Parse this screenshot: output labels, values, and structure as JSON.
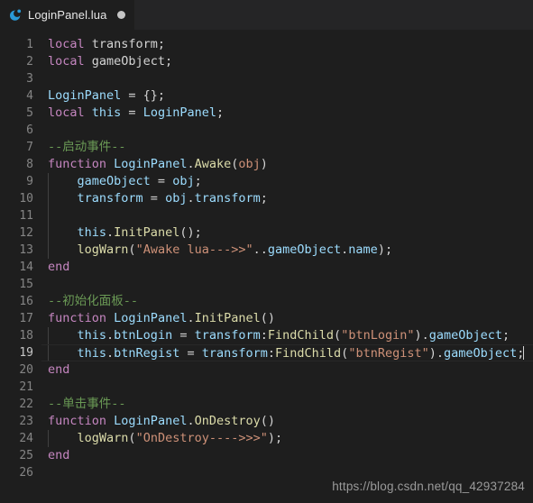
{
  "window": {
    "background_color": "#1e1e1e",
    "tabbar_color": "#252526"
  },
  "tabbar": {
    "tabs": [
      {
        "label": "LoginPanel.lua",
        "icon": "lua-moon-icon",
        "dirty_indicator": "dirty-dot",
        "active": true
      }
    ]
  },
  "editor": {
    "language": "lua",
    "active_line": 19,
    "cursor_line": 19,
    "colors": {
      "keyword": "#c586c0",
      "variable": "#9cdcfe",
      "function": "#dcdcaa",
      "string": "#ce9178",
      "comment": "#6a9955",
      "plain": "#d4d4d4",
      "line_number": "#858585",
      "paren": "#ffd700"
    },
    "lines": [
      {
        "n": "1",
        "indent_guide": false,
        "tokens": [
          {
            "t": "local",
            "c": "kw"
          },
          {
            "t": " transform;",
            "c": "plain"
          }
        ]
      },
      {
        "n": "2",
        "indent_guide": false,
        "tokens": [
          {
            "t": "local",
            "c": "kw"
          },
          {
            "t": " gameObject;",
            "c": "plain"
          }
        ]
      },
      {
        "n": "3",
        "indent_guide": false,
        "tokens": []
      },
      {
        "n": "4",
        "indent_guide": false,
        "tokens": [
          {
            "t": "LoginPanel",
            "c": "var"
          },
          {
            "t": " = {};",
            "c": "plain"
          }
        ]
      },
      {
        "n": "5",
        "indent_guide": false,
        "tokens": [
          {
            "t": "local",
            "c": "kw"
          },
          {
            "t": " ",
            "c": "plain"
          },
          {
            "t": "this",
            "c": "var"
          },
          {
            "t": " = ",
            "c": "plain"
          },
          {
            "t": "LoginPanel",
            "c": "var"
          },
          {
            "t": ";",
            "c": "plain"
          }
        ]
      },
      {
        "n": "6",
        "indent_guide": false,
        "tokens": []
      },
      {
        "n": "7",
        "indent_guide": false,
        "tokens": [
          {
            "t": "--启动事件--",
            "c": "comment"
          }
        ]
      },
      {
        "n": "8",
        "indent_guide": false,
        "tokens": [
          {
            "t": "function",
            "c": "kw"
          },
          {
            "t": " ",
            "c": "plain"
          },
          {
            "t": "LoginPanel",
            "c": "var"
          },
          {
            "t": ".",
            "c": "plain"
          },
          {
            "t": "Awake",
            "c": "func"
          },
          {
            "t": "(",
            "c": "plain"
          },
          {
            "t": "obj",
            "c": "param"
          },
          {
            "t": ")",
            "c": "plain"
          }
        ]
      },
      {
        "n": "9",
        "indent_guide": true,
        "tokens": [
          {
            "t": "    ",
            "c": "plain"
          },
          {
            "t": "gameObject",
            "c": "var"
          },
          {
            "t": " = ",
            "c": "plain"
          },
          {
            "t": "obj",
            "c": "var"
          },
          {
            "t": ";",
            "c": "plain"
          }
        ]
      },
      {
        "n": "10",
        "indent_guide": true,
        "tokens": [
          {
            "t": "    ",
            "c": "plain"
          },
          {
            "t": "transform",
            "c": "var"
          },
          {
            "t": " = ",
            "c": "plain"
          },
          {
            "t": "obj",
            "c": "var"
          },
          {
            "t": ".",
            "c": "plain"
          },
          {
            "t": "transform",
            "c": "var"
          },
          {
            "t": ";",
            "c": "plain"
          }
        ]
      },
      {
        "n": "11",
        "indent_guide": true,
        "tokens": []
      },
      {
        "n": "12",
        "indent_guide": true,
        "tokens": [
          {
            "t": "    ",
            "c": "plain"
          },
          {
            "t": "this",
            "c": "var"
          },
          {
            "t": ".",
            "c": "plain"
          },
          {
            "t": "InitPanel",
            "c": "func"
          },
          {
            "t": "();",
            "c": "plain"
          }
        ]
      },
      {
        "n": "13",
        "indent_guide": true,
        "tokens": [
          {
            "t": "    ",
            "c": "plain"
          },
          {
            "t": "logWarn",
            "c": "func"
          },
          {
            "t": "(",
            "c": "plain"
          },
          {
            "t": "\"Awake lua--->>\"",
            "c": "str"
          },
          {
            "t": "..",
            "c": "plain"
          },
          {
            "t": "gameObject",
            "c": "var"
          },
          {
            "t": ".",
            "c": "plain"
          },
          {
            "t": "name",
            "c": "var"
          },
          {
            "t": ");",
            "c": "plain"
          }
        ]
      },
      {
        "n": "14",
        "indent_guide": false,
        "tokens": [
          {
            "t": "end",
            "c": "kw"
          }
        ]
      },
      {
        "n": "15",
        "indent_guide": false,
        "tokens": []
      },
      {
        "n": "16",
        "indent_guide": false,
        "tokens": [
          {
            "t": "--初始化面板--",
            "c": "comment"
          }
        ]
      },
      {
        "n": "17",
        "indent_guide": false,
        "tokens": [
          {
            "t": "function",
            "c": "kw"
          },
          {
            "t": " ",
            "c": "plain"
          },
          {
            "t": "LoginPanel",
            "c": "var"
          },
          {
            "t": ".",
            "c": "plain"
          },
          {
            "t": "InitPanel",
            "c": "func"
          },
          {
            "t": "()",
            "c": "plain"
          }
        ]
      },
      {
        "n": "18",
        "indent_guide": true,
        "tokens": [
          {
            "t": "    ",
            "c": "plain"
          },
          {
            "t": "this",
            "c": "var"
          },
          {
            "t": ".",
            "c": "plain"
          },
          {
            "t": "btnLogin",
            "c": "var"
          },
          {
            "t": " = ",
            "c": "plain"
          },
          {
            "t": "transform",
            "c": "var"
          },
          {
            "t": ":",
            "c": "plain"
          },
          {
            "t": "FindChild",
            "c": "func"
          },
          {
            "t": "(",
            "c": "plain"
          },
          {
            "t": "\"btnLogin\"",
            "c": "str"
          },
          {
            "t": ").",
            "c": "plain"
          },
          {
            "t": "gameObject",
            "c": "var"
          },
          {
            "t": ";",
            "c": "plain"
          }
        ]
      },
      {
        "n": "19",
        "indent_guide": true,
        "active": true,
        "caret": true,
        "tokens": [
          {
            "t": "    ",
            "c": "plain"
          },
          {
            "t": "this",
            "c": "var"
          },
          {
            "t": ".",
            "c": "plain"
          },
          {
            "t": "btnRegist",
            "c": "var"
          },
          {
            "t": " = ",
            "c": "plain"
          },
          {
            "t": "transform",
            "c": "var"
          },
          {
            "t": ":",
            "c": "plain"
          },
          {
            "t": "FindChild",
            "c": "func"
          },
          {
            "t": "(",
            "c": "plain"
          },
          {
            "t": "\"btnRegist\"",
            "c": "str"
          },
          {
            "t": ").",
            "c": "plain"
          },
          {
            "t": "gameObject",
            "c": "var"
          },
          {
            "t": ";",
            "c": "plain"
          }
        ]
      },
      {
        "n": "20",
        "indent_guide": false,
        "tokens": [
          {
            "t": "end",
            "c": "kw"
          }
        ]
      },
      {
        "n": "21",
        "indent_guide": false,
        "tokens": []
      },
      {
        "n": "22",
        "indent_guide": false,
        "tokens": [
          {
            "t": "--单击事件--",
            "c": "comment"
          }
        ]
      },
      {
        "n": "23",
        "indent_guide": false,
        "tokens": [
          {
            "t": "function",
            "c": "kw"
          },
          {
            "t": " ",
            "c": "plain"
          },
          {
            "t": "LoginPanel",
            "c": "var"
          },
          {
            "t": ".",
            "c": "plain"
          },
          {
            "t": "OnDestroy",
            "c": "func"
          },
          {
            "t": "()",
            "c": "plain"
          }
        ]
      },
      {
        "n": "24",
        "indent_guide": true,
        "tokens": [
          {
            "t": "    ",
            "c": "plain"
          },
          {
            "t": "logWarn",
            "c": "func"
          },
          {
            "t": "(",
            "c": "plain"
          },
          {
            "t": "\"OnDestroy---->>>\"",
            "c": "str"
          },
          {
            "t": ");",
            "c": "plain"
          }
        ]
      },
      {
        "n": "25",
        "indent_guide": false,
        "tokens": [
          {
            "t": "end",
            "c": "kw"
          }
        ]
      },
      {
        "n": "26",
        "indent_guide": false,
        "tokens": []
      }
    ]
  },
  "watermark": {
    "text": "https://blog.csdn.net/qq_42937284"
  }
}
